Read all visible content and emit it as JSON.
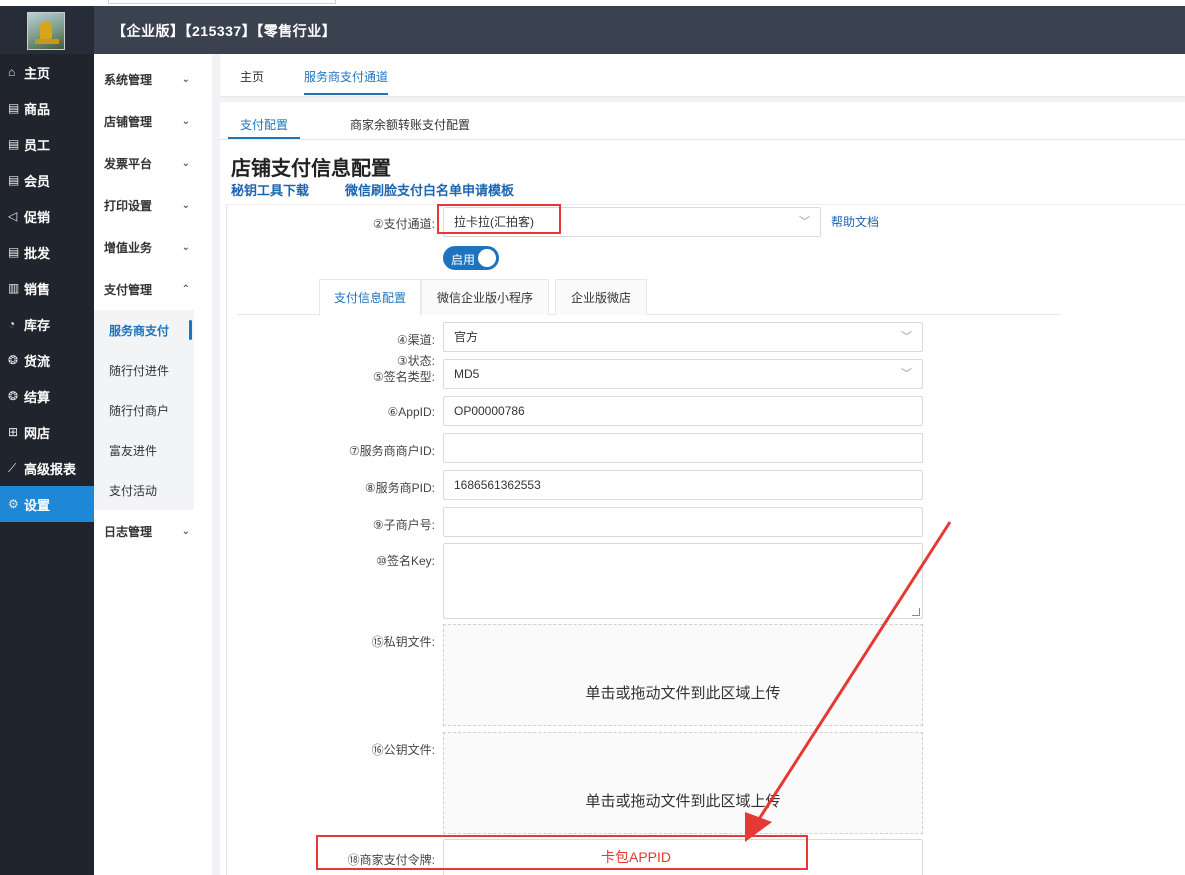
{
  "header": {
    "title": "【企业版】【215337】【零售行业】"
  },
  "sidebar": {
    "items": [
      {
        "icon": "⌂",
        "label": "主页"
      },
      {
        "icon": "▤",
        "label": "商品"
      },
      {
        "icon": "▤",
        "label": "员工"
      },
      {
        "icon": "▤",
        "label": "会员"
      },
      {
        "icon": "◁",
        "label": "促销"
      },
      {
        "icon": "▤",
        "label": "批发"
      },
      {
        "icon": "▥",
        "label": "销售"
      },
      {
        "icon": "◔",
        "label": "库存"
      },
      {
        "icon": "❂",
        "label": "货流"
      },
      {
        "icon": "❂",
        "label": "结算"
      },
      {
        "icon": "⊞",
        "label": "网店"
      },
      {
        "icon": "⟋",
        "label": "高级报表"
      },
      {
        "icon": "⚙",
        "label": "设置"
      }
    ],
    "active_index": 12
  },
  "subnav": {
    "groups": [
      {
        "label": "系统管理",
        "chevron": "⌄"
      },
      {
        "label": "店铺管理",
        "chevron": "⌄"
      },
      {
        "label": "发票平台",
        "chevron": "⌄"
      },
      {
        "label": "打印设置",
        "chevron": "⌄"
      },
      {
        "label": "增值业务",
        "chevron": "⌄"
      },
      {
        "label": "支付管理",
        "chevron": "⌃"
      }
    ],
    "children": [
      "服务商支付",
      "随行付进件",
      "随行付商户",
      "富友进件",
      "支付活动"
    ],
    "last_group": {
      "label": "日志管理",
      "chevron": "⌄"
    }
  },
  "top_tabs": [
    "主页",
    "服务商支付通道"
  ],
  "sub_tabs": [
    "支付配置",
    "商家余额转账支付配置"
  ],
  "page": {
    "title": "店铺支付信息配置",
    "link_tool": "秘钥工具下载",
    "link_template": "微信刷脸支付白名单申请模板",
    "help_link": "帮助文档"
  },
  "form": {
    "channel_label": "②支付通道:",
    "channel_value": "拉卡拉(汇拍客)",
    "status_label": "③状态:",
    "status_value": "启用",
    "inner_tabs": [
      "支付信息配置",
      "微信企业版小程序",
      "企业版微店"
    ],
    "route_label": "④渠道:",
    "route_value": "官方",
    "sign_type_label": "⑤签名类型:",
    "sign_type_value": "MD5",
    "appid_label": "⑥AppID:",
    "appid_value": "OP00000786",
    "merchant_id_label": "⑦服务商商户ID:",
    "merchant_id_value": "",
    "pid_label": "⑧服务商PID:",
    "pid_value": "1686561362553",
    "sub_merchant_label": "⑨子商户号:",
    "sub_merchant_value": "",
    "sign_key_label": "⑩签名Key:",
    "private_key_label": "⑮私钥文件:",
    "public_key_label": "⑯公钥文件:",
    "upload_hint": "单击或拖动文件到此区域上传",
    "token_label": "⑱商家支付令牌:",
    "token_annotation": "卡包APPID"
  },
  "colors": {
    "accent": "#1e73be",
    "header_bg": "#3a4250",
    "sidebar_bg": "#20242d",
    "annotation_red": "#e53935"
  }
}
